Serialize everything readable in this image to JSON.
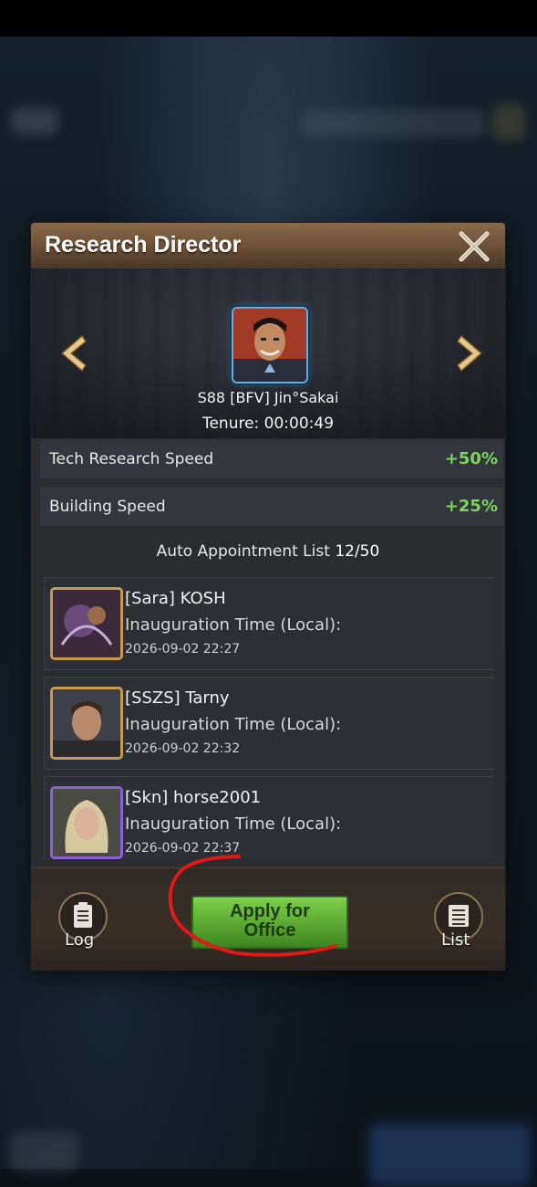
{
  "dialog": {
    "title": "Research Director"
  },
  "officer": {
    "name": "S88 [BFV] Jin°Sakai",
    "tenure": "Tenure: 00:00:49"
  },
  "stats": [
    {
      "label": "Tech Research Speed",
      "value": "+50%"
    },
    {
      "label": "Building Speed",
      "value": "+25%"
    }
  ],
  "auto_list": {
    "label": "Auto Appointment List",
    "count": "12/50"
  },
  "appointments": [
    {
      "name": "[Sara] KOSH",
      "sub": "Inauguration Time (Local):",
      "time": "2026-09-02 22:27"
    },
    {
      "name": "[SSZS] Tarny",
      "sub": "Inauguration Time (Local):",
      "time": "2026-09-02 22:32"
    },
    {
      "name": "[Skn] horse2001",
      "sub": "Inauguration Time (Local):",
      "time": "2026-09-02 22:37"
    }
  ],
  "buttons": {
    "log": "Log",
    "apply_line1": "Apply for",
    "apply_line2": "Office",
    "list": "List"
  },
  "colors": {
    "accent_green": "#7ad65a",
    "apply_button": "#5aa832",
    "annotation_red": "#e01818"
  },
  "icons": {
    "close": "close-icon",
    "prev": "chevron-left-icon",
    "next": "chevron-right-icon",
    "log": "clipboard-icon",
    "list": "list-icon"
  }
}
